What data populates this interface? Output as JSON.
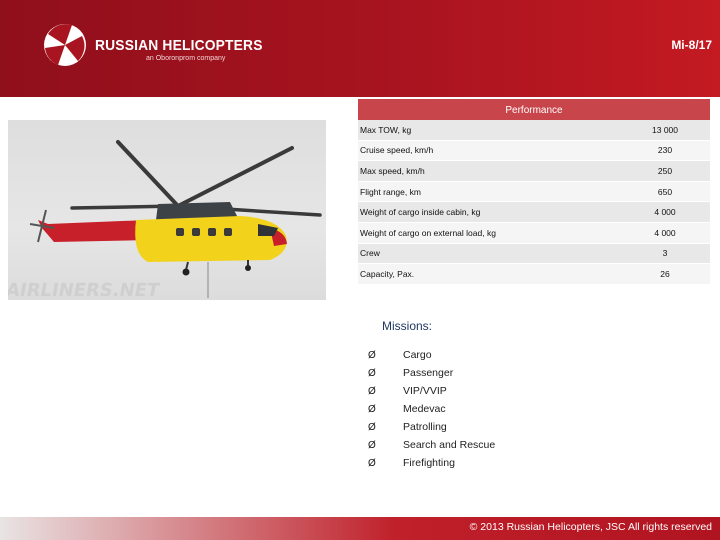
{
  "header": {
    "brand_name": "RUSSIAN HELICOPTERS",
    "brand_sub": "an Oboronprom company",
    "model": "Mi-8/17",
    "colors": {
      "header": "#a8141f",
      "table_header": "#c8454b"
    }
  },
  "photo": {
    "icon": "helicopter-photo"
  },
  "performance": {
    "title": "Performance",
    "rows": [
      {
        "label": "Max TOW, kg",
        "value": "13 000"
      },
      {
        "label": "Cruise speed, km/h",
        "value": "230"
      },
      {
        "label": "Max speed, km/h",
        "value": "250"
      },
      {
        "label": "Flight range, km",
        "value": "650"
      },
      {
        "label": "Weight of cargo inside cabin, kg",
        "value": "4 000"
      },
      {
        "label": "Weight of cargo on external load, kg",
        "value": "4 000"
      },
      {
        "label": "Crew",
        "value": "3"
      },
      {
        "label": "Capacity, Pax.",
        "value": "26"
      }
    ]
  },
  "missions": {
    "title": "Missions:",
    "bullet": "Ø",
    "items": [
      "Cargo",
      "Passenger",
      "VIP/VVIP",
      "Medevac",
      "Patrolling",
      "Search and Rescue",
      "Firefighting"
    ]
  },
  "footer": {
    "copyright": "© 2013 Russian Helicopters, JSC All rights reserved"
  }
}
